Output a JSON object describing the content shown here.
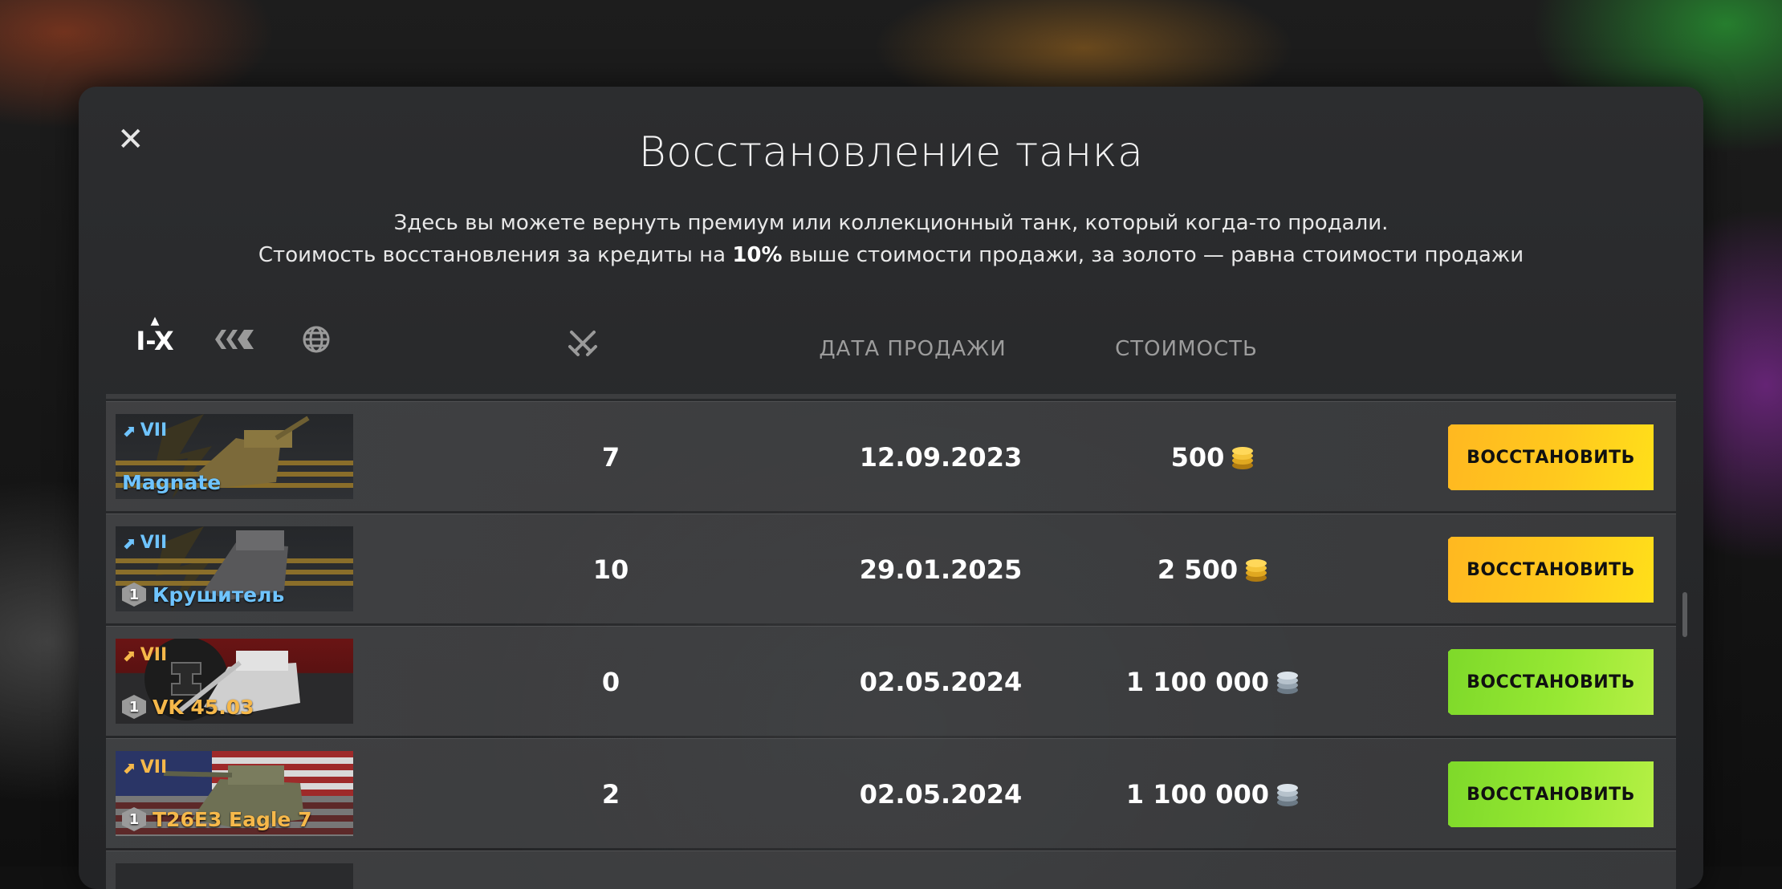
{
  "dialog": {
    "title": "Восстановление танка",
    "desc_line1": "Здесь вы можете вернуть премиум или коллекционный танк, который когда-то продали.",
    "desc_line2_a": "Стоимость восстановления за кредиты на ",
    "desc_line2_bold": "10%",
    "desc_line2_b": " выше стоимости продажи, за золото — равна стоимости продажи",
    "close_icon": "close-icon"
  },
  "filters": {
    "tier_label": "I-X",
    "type_icon": "vehicle-type-icon",
    "nation_icon": "globe-icon"
  },
  "columns": {
    "battles_icon": "crossed-swords-icon",
    "date": "ДАТА ПРОДАЖИ",
    "cost": "СТОИМОСТЬ"
  },
  "rows": [
    {
      "tier": "VII",
      "name": "Magnate",
      "name_color": "#6fc4ff",
      "mastery": "",
      "battles": "7",
      "date": "12.09.2023",
      "cost": "500",
      "currency": "gold",
      "button": "ВОССТАНОВИТЬ"
    },
    {
      "tier": "VII",
      "name": "Крушитель",
      "name_color": "#6fc4ff",
      "mastery": "1",
      "battles": "10",
      "date": "29.01.2025",
      "cost": "2 500",
      "currency": "gold",
      "button": "ВОССТАНОВИТЬ"
    },
    {
      "tier": "VII",
      "name": "VK 45.03",
      "name_color": "#f6b84a",
      "mastery": "1",
      "battles": "0",
      "date": "02.05.2024",
      "cost": "1 100 000",
      "currency": "credits",
      "button": "ВОССТАНОВИТЬ"
    },
    {
      "tier": "VII",
      "name": "T26E3 Eagle 7",
      "name_color": "#f6b84a",
      "mastery": "1",
      "battles": "2",
      "date": "02.05.2024",
      "cost": "1 100 000",
      "currency": "credits",
      "button": "ВОССТАНОВИТЬ"
    }
  ]
}
